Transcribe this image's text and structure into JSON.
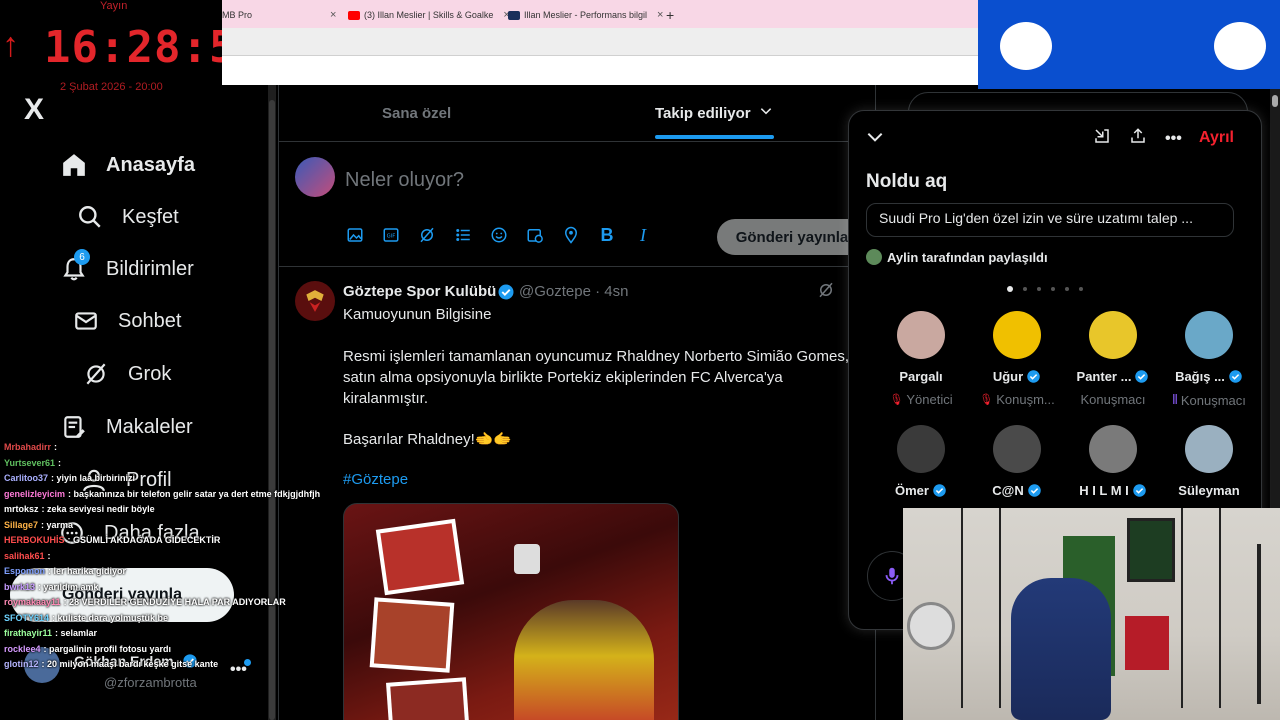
{
  "clock": {
    "label": "Yayın",
    "time": "16:28:56",
    "date": "2 Şubat 2026 - 20:00"
  },
  "browser": {
    "tabs": [
      {
        "title": "MB Pro",
        "close": "×"
      },
      {
        "title": "(3) Illan Meslier | Skills & Goalke",
        "close": "×"
      },
      {
        "title": "Illan Meslier - Performans bilgil",
        "close": "×"
      }
    ],
    "new_tab": "+"
  },
  "sidebar": {
    "logo": "X",
    "items": [
      {
        "label": "Anasayfa",
        "icon": "home-icon"
      },
      {
        "label": "Keşfet",
        "icon": "search-icon"
      },
      {
        "label": "Bildirimler",
        "icon": "bell-icon",
        "badge": "6"
      },
      {
        "label": "Sohbet",
        "icon": "mail-icon"
      },
      {
        "label": "Grok",
        "icon": "grok-icon"
      },
      {
        "label": "Makaleler",
        "icon": "article-icon"
      },
      {
        "label": "Profil",
        "icon": "person-icon"
      },
      {
        "label": "Daha fazla",
        "icon": "more-circle-icon"
      }
    ],
    "post_button": "Gönderi yayınla",
    "account": {
      "name": "Gökhan Erdem",
      "handle": "@zforzambrotta"
    }
  },
  "chat": [
    {
      "user": "Mrbahadirr",
      "msg": ":",
      "color": "#e04a4a"
    },
    {
      "user": "Yurtsever61",
      "msg": ":",
      "color": "#60c060"
    },
    {
      "user": "Carlitoo37",
      "msg": ": yiyin laa birbirinizi",
      "color": "#aab0ff"
    },
    {
      "user": "genelizleyicim",
      "msg": ": başkanınıza bir telefon gelir satar ya dert etme fdkjgjdhfjh",
      "color": "#ff7ad9"
    },
    {
      "user": "mrtoksz",
      "msg": ": zeka seviyesi nedir böyle",
      "color": "#ffffff"
    },
    {
      "user": "Sillage7",
      "msg": ": yarma",
      "color": "#ffb347"
    },
    {
      "user": "HERBOKUHİS",
      "msg": ": GSÜMLİ AKDAĞADA GİDECEKTİR",
      "color": "#ff4d4d"
    },
    {
      "user": "salihak61",
      "msg": ":",
      "color": "#ff4d4d"
    },
    {
      "user": "Espomon",
      "msg": ": ler harika gidiyor",
      "color": "#7fa0ff"
    },
    {
      "user": "bwrk13",
      "msg": ": yarıldım amk",
      "color": "#c79bff"
    },
    {
      "user": "roymakaay11",
      "msg": ": 28 VERDİLER GENDUZİYE HALA PAR ADIYORLAR",
      "color": "#ff8ab5"
    },
    {
      "user": "SFOTY614",
      "msg": ": kuliste dara yolmuştük be",
      "color": "#6ed3ff"
    },
    {
      "user": "firathayir11",
      "msg": ": selamlar",
      "color": "#9dff9d"
    },
    {
      "user": "rocklee4",
      "msg": ": pargalinin profil fotosu yardı",
      "color": "#d79bff"
    },
    {
      "user": "glotin12",
      "msg": ": 20 milyon maaşı bardı keşke gitse kante",
      "color": "#b5b5ff"
    }
  ],
  "main": {
    "tabs": [
      {
        "label": "Sana özel"
      },
      {
        "label": "Takip ediliyor"
      }
    ],
    "compose": {
      "placeholder": "Neler oluyor?",
      "button": "Gönderi yayınla"
    },
    "tweet": {
      "name": "Göztepe Spor Kulübü",
      "handle": "@Goztepe · 4sn",
      "lines": [
        "Kamuoyunun Bilgisine",
        "",
        "Resmi işlemleri tamamlanan oyuncumuz Rhaldney Norberto Simião Gomes,",
        "satın alma opsiyonuyla birlikte Portekiz ekiplerinden FC Alverca'ya",
        "kiralanmıştır.",
        "",
        "Başarılar Rhaldney!🫲🫱"
      ],
      "hashtag": "#Göztepe"
    }
  },
  "space": {
    "leave": "Ayrıl",
    "title": "Noldu aq",
    "pinned": "Suudi Pro Lig'den özel izin ve süre uzatımı talep ...",
    "shared_by": "Aylin tarafından paylaşıldı",
    "speakers": [
      {
        "name": "Pargalı",
        "role": "Yönetici",
        "verified": false,
        "muted": true,
        "color": "#c9a8a0"
      },
      {
        "name": "Uğur",
        "role": "Konuşm...",
        "verified": true,
        "muted": true,
        "color": "#f0c000"
      },
      {
        "name": "Panter ...",
        "role": "Konuşmacı",
        "verified": true,
        "muted": false,
        "color": "#e8c62a"
      },
      {
        "name": "Bağış ...",
        "role": "Konuşmacı",
        "verified": true,
        "muted": false,
        "speaking": true,
        "color": "#6aa8c8"
      },
      {
        "name": "Ömer",
        "role": "",
        "verified": true,
        "muted": true,
        "color": "#3a3a3a"
      },
      {
        "name": "C@N",
        "role": "",
        "verified": true,
        "muted": false,
        "color": "#4a4a4a"
      },
      {
        "name": "H I L M I",
        "role": "",
        "verified": true,
        "muted": false,
        "color": "#7a7a7a"
      },
      {
        "name": "Süleyman",
        "role": "",
        "verified": false,
        "muted": false,
        "color": "#9ab0c0"
      }
    ]
  },
  "colors": {
    "accent": "#1d9bf0",
    "danger": "#f4212e",
    "bg": "#000000"
  }
}
